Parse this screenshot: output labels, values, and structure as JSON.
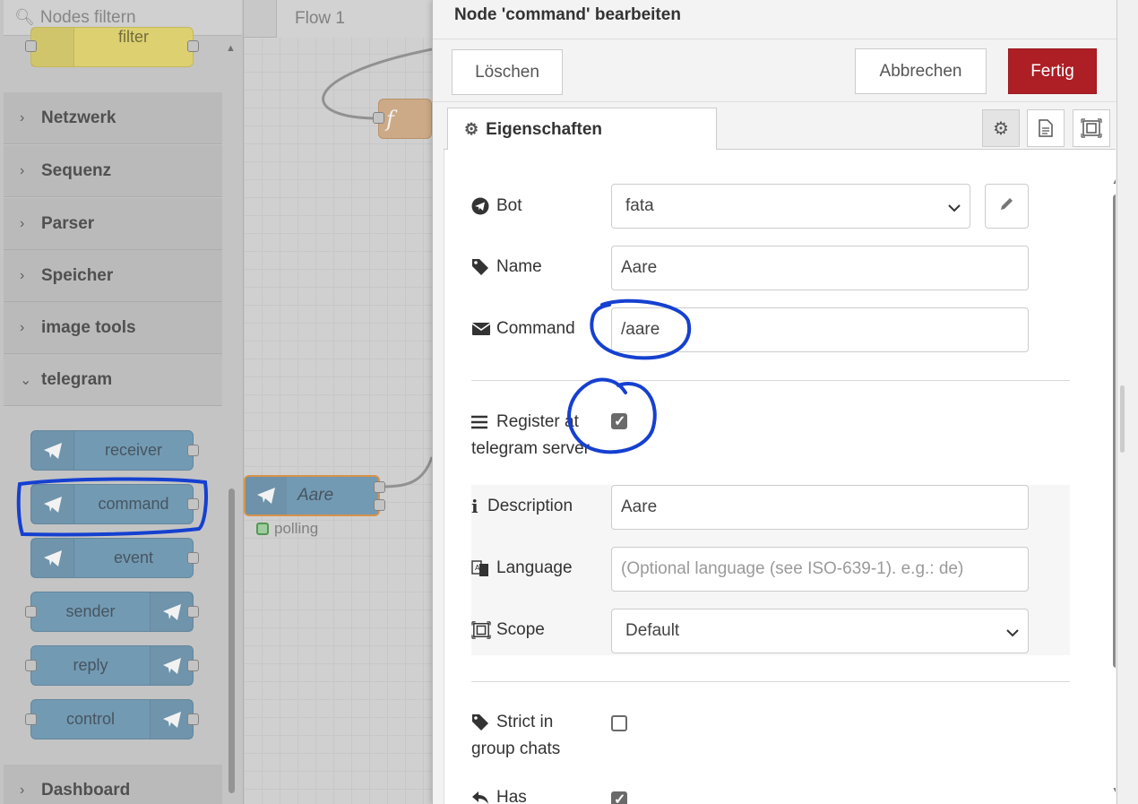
{
  "palette": {
    "search_placeholder": "Nodes filtern",
    "top_node_label": "filter",
    "categories": [
      "Netzwerk",
      "Sequenz",
      "Parser",
      "Speicher",
      "image tools",
      "telegram",
      "Dashboard"
    ],
    "nodes": [
      "receiver",
      "command",
      "event",
      "sender",
      "reply",
      "control"
    ]
  },
  "workspace": {
    "tab": "Flow 1",
    "node_label": "Aare",
    "node_status": "polling",
    "function_node_symbol": "f"
  },
  "tray": {
    "title": "Node 'command' bearbeiten",
    "delete_label": "Löschen",
    "cancel_label": "Abbrechen",
    "done_label": "Fertig",
    "properties_tab": "Eigenschaften",
    "fields": {
      "bot_label": "Bot",
      "bot_value": "fata",
      "name_label": "Name",
      "name_value": "Aare",
      "command_label": "Command",
      "command_value": "/aare",
      "register_label_1": "Register at",
      "register_label_2": "telegram server",
      "register_checked": true,
      "description_label": "Description",
      "description_value": "Aare",
      "language_label": "Language",
      "language_placeholder": "(Optional language (see ISO-639-1). e.g.: de)",
      "scope_label": "Scope",
      "scope_value": "Default",
      "strict_label_1": "Strict in",
      "strict_label_2": "group chats",
      "strict_checked": false,
      "has_label": "Has",
      "has_checked": true
    }
  },
  "colors": {
    "node_blue": "#7aa3bd",
    "primary_red": "#ad1f25",
    "annotation_blue": "#1540d0"
  }
}
